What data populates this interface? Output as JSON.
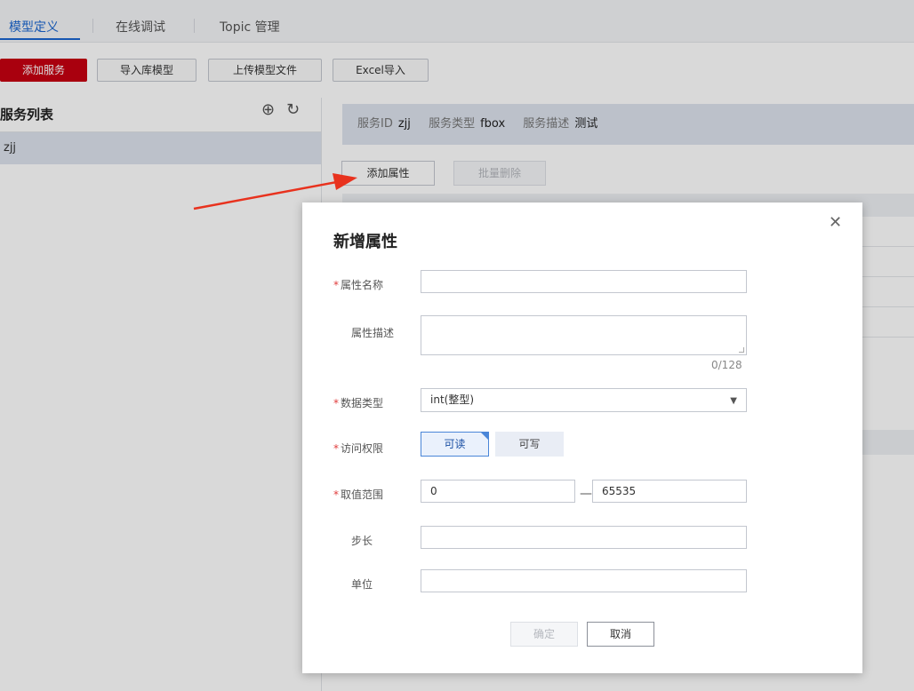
{
  "tabs": [
    {
      "label": "模型定义"
    },
    {
      "label": "在线调试"
    },
    {
      "label": "Topic 管理"
    }
  ],
  "toolbar": {
    "add_service": "添加服务",
    "import_lib_model": "导入库模型",
    "upload_model_file": "上传模型文件",
    "excel_import": "Excel导入"
  },
  "services": {
    "title": "服务列表",
    "items": [
      {
        "name": "zjj"
      }
    ]
  },
  "service_info": {
    "id_label": "服务ID",
    "id_value": "zjj",
    "type_label": "服务类型",
    "type_value": "fbox",
    "desc_label": "服务描述",
    "desc_value": "测试"
  },
  "properties": {
    "add_label": "添加属性",
    "batch_delete_label": "批量删除"
  },
  "dialog": {
    "title": "新增属性",
    "required_mark": "*",
    "name_label": "属性名称",
    "name_value": "",
    "desc_label": "属性描述",
    "desc_value": "",
    "desc_counter": "0/128",
    "type_label": "数据类型",
    "type_value": "int(整型)",
    "access_label": "访问权限",
    "access_read": "可读",
    "access_write": "可写",
    "range_label": "取值范围",
    "range_min": "0",
    "range_dash": "—",
    "range_max": "65535",
    "step_label": "步长",
    "step_value": "",
    "unit_label": "单位",
    "unit_value": "",
    "ok_label": "确定",
    "cancel_label": "取消"
  },
  "colors": {
    "primary_red": "#c70011",
    "accent_blue": "#1a66d0",
    "required_red": "#e03c3c",
    "selected_blue": "#4a86d8"
  }
}
